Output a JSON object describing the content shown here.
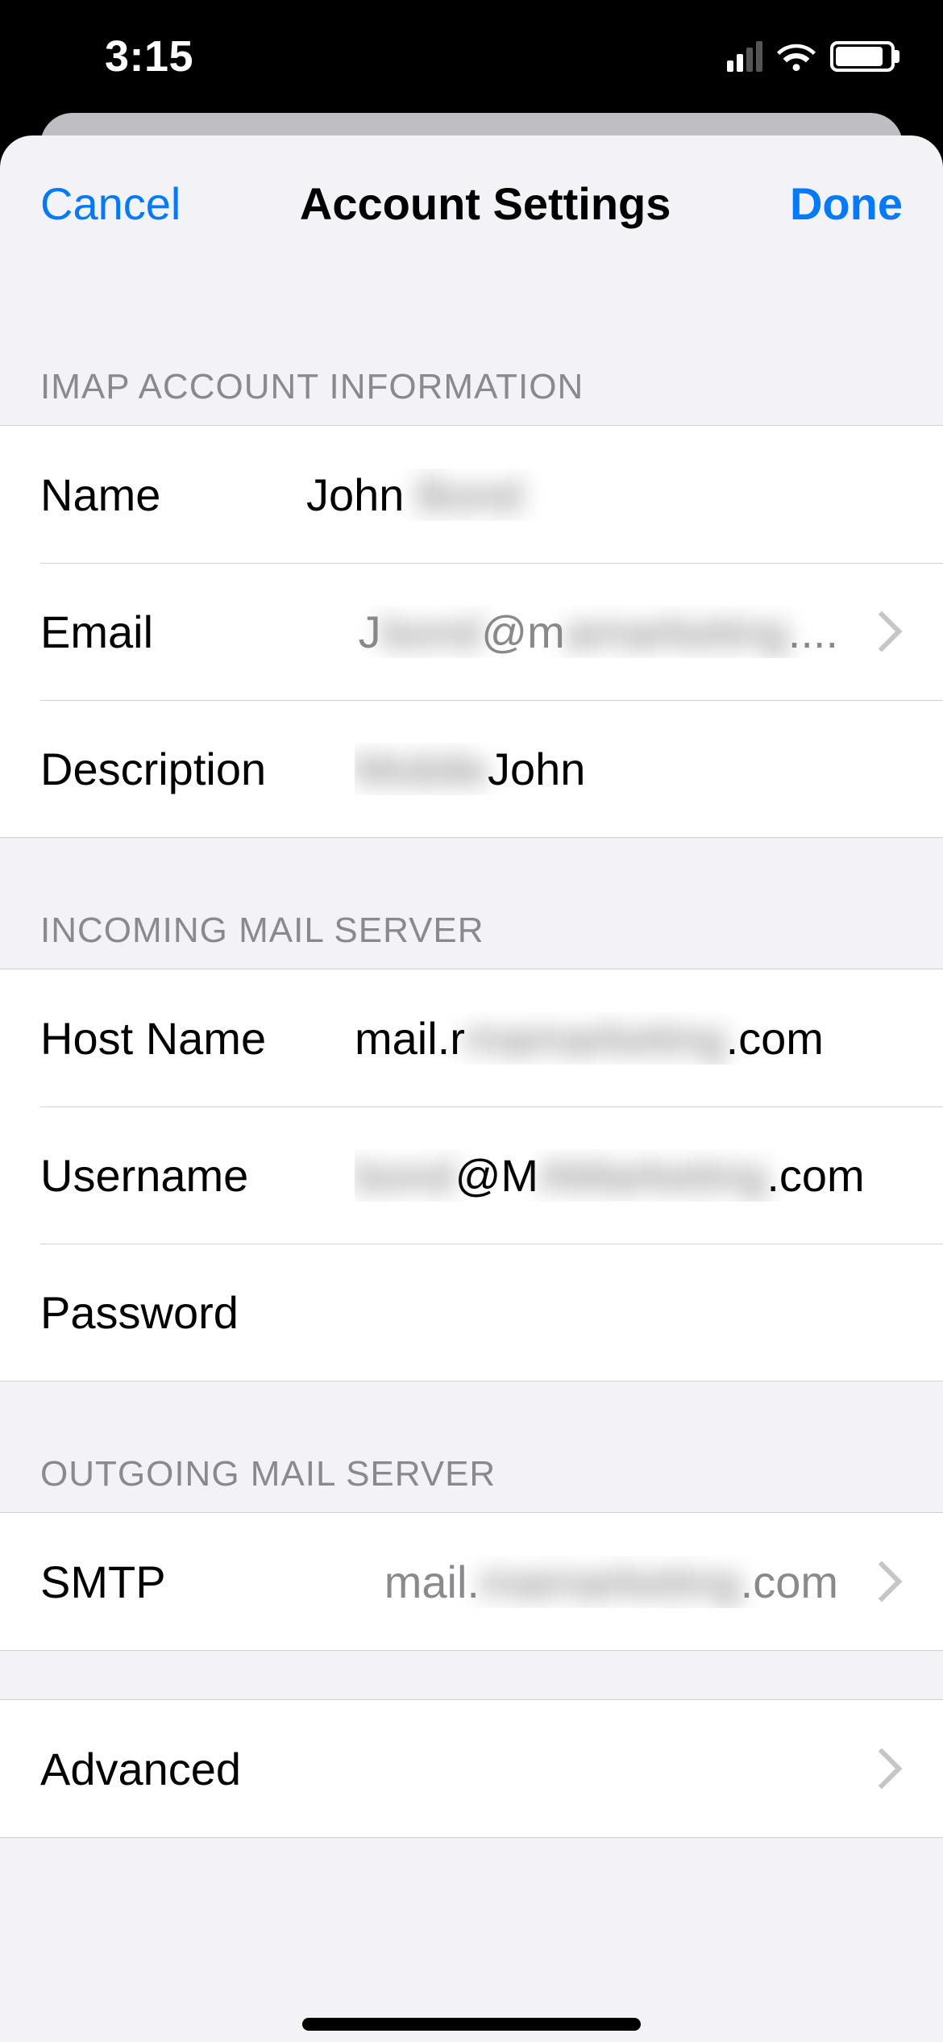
{
  "status": {
    "time": "3:15"
  },
  "nav": {
    "cancel": "Cancel",
    "title": "Account Settings",
    "done": "Done"
  },
  "sections": {
    "imap": {
      "header": "IMAP ACCOUNT INFORMATION",
      "name_label": "Name",
      "name_value_pre": "John ",
      "name_value_blur": "Bond",
      "email_label": "Email",
      "email_value_pre": "J",
      "email_value_blur1": "bond",
      "email_value_mid": "@m",
      "email_value_blur2": "amarketing",
      "email_value_post": "....",
      "description_label": "Description",
      "description_value_blur": "Mobile",
      "description_value_post": "John"
    },
    "incoming": {
      "header": "INCOMING MAIL SERVER",
      "host_label": "Host Name",
      "host_pre": "mail.r",
      "host_blur": "mamarketing",
      "host_post": ".com",
      "user_label": "Username",
      "user_blur1": "bond",
      "user_mid": "@M",
      "user_blur2": "AMarketing",
      "user_post": ".com",
      "password_label": "Password",
      "password_value": ""
    },
    "outgoing": {
      "header": "OUTGOING MAIL SERVER",
      "smtp_label": "SMTP",
      "smtp_pre": "mail.",
      "smtp_blur": "mamarketing",
      "smtp_post": ".com"
    },
    "advanced": {
      "label": "Advanced"
    }
  }
}
